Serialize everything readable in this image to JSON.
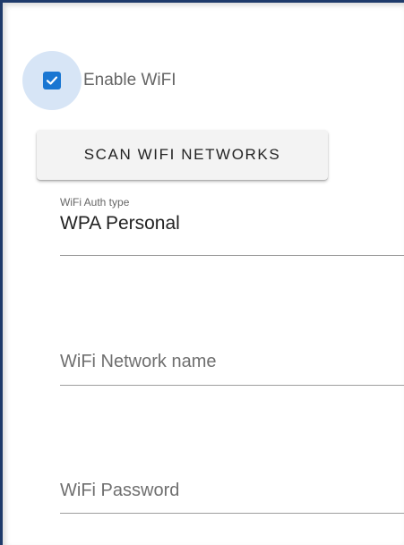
{
  "wifi": {
    "enable_label": "Enable WiFI",
    "enabled": true,
    "scan_button_label": "SCAN WIFI NETWORKS",
    "auth_type": {
      "label": "WiFi Auth type",
      "value": "WPA Personal"
    },
    "network_name": {
      "placeholder": "WiFi Network name",
      "value": ""
    },
    "password": {
      "placeholder": "WiFi Password",
      "value": ""
    }
  },
  "colors": {
    "accent": "#1976d2",
    "checkbox_halo": "#d7e5f6",
    "frame_border": "#1f3b6b"
  },
  "icons": {
    "checkbox": "checkmark-icon"
  }
}
